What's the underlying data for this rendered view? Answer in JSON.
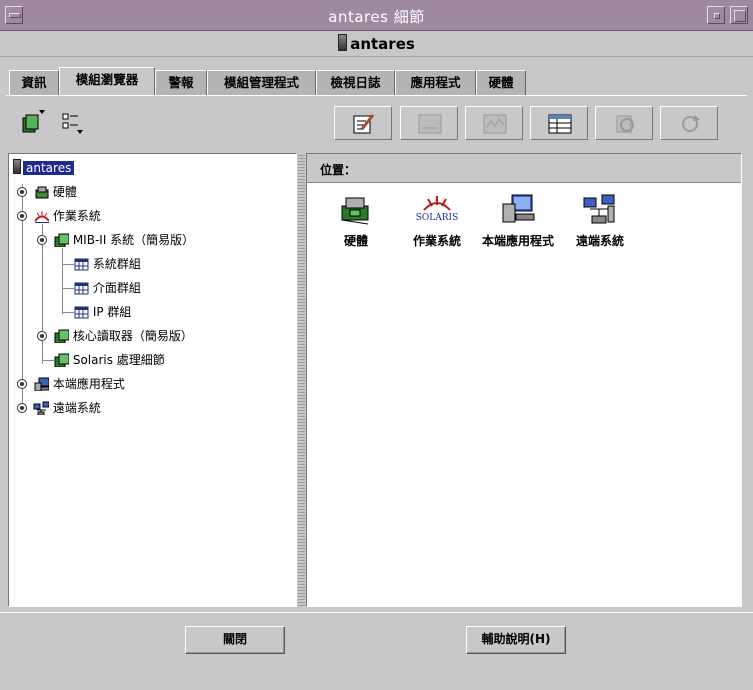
{
  "window": {
    "title": "antares 細節"
  },
  "host": {
    "name": "antares"
  },
  "tabs": [
    {
      "label": "資訊"
    },
    {
      "label": "模組瀏覽器"
    },
    {
      "label": "警報"
    },
    {
      "label": "模組管理程式"
    },
    {
      "label": "檢視日誌"
    },
    {
      "label": "應用程式"
    },
    {
      "label": "硬體"
    }
  ],
  "active_tab": "模組瀏覽器",
  "toolbar": {
    "left_icons": [
      "tree-view-icon",
      "list-view-icon"
    ],
    "right_icons": [
      "edit-icon",
      "graph-icon",
      "plot-icon",
      "table-icon",
      "refresh-icon",
      "reload-icon"
    ]
  },
  "tree": {
    "root": "antares",
    "items": [
      {
        "label": "硬體",
        "icon": "hardware-icon"
      },
      {
        "label": "作業系統",
        "icon": "solaris-icon"
      },
      {
        "label": "MIB-II 系統（簡易版）",
        "icon": "module-icon"
      },
      {
        "label": "系統群組",
        "icon": "table-icon"
      },
      {
        "label": "介面群組",
        "icon": "table-icon"
      },
      {
        "label": "IP 群組",
        "icon": "table-icon"
      },
      {
        "label": "核心讀取器（簡易版）",
        "icon": "module-icon"
      },
      {
        "label": "Solaris 處理細節",
        "icon": "module-icon"
      },
      {
        "label": "本端應用程式",
        "icon": "local-app-icon"
      },
      {
        "label": "遠端系統",
        "icon": "remote-system-icon"
      }
    ]
  },
  "location": {
    "label": "位置："
  },
  "content_icons": [
    {
      "label": "硬體",
      "icon": "hardware-icon"
    },
    {
      "label": "作業系統",
      "icon": "solaris-icon",
      "logo_text": "SOLARIS"
    },
    {
      "label": "本端應用程式",
      "icon": "local-app-icon"
    },
    {
      "label": "遠端系統",
      "icon": "remote-system-icon"
    }
  ],
  "buttons": {
    "close": "關閉",
    "help": "輔助說明(H)"
  },
  "colors": {
    "titlebar": "#9e8a9e",
    "selection": "#1f2a8f",
    "background": "#c8c8c8"
  }
}
